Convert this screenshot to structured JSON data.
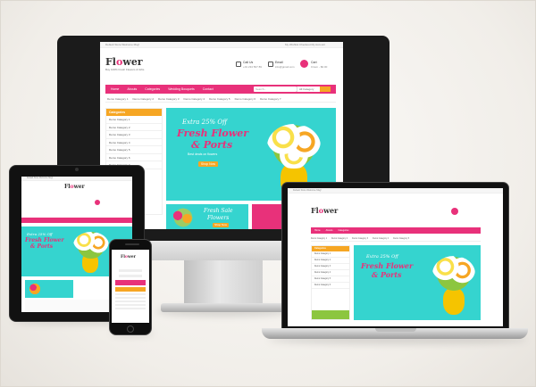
{
  "brand": {
    "logo_a": "Fl",
    "logo_o": "o",
    "logo_b": "wer",
    "tagline": "Buy 100% Fresh Flowers & Gifts"
  },
  "topbar": {
    "welcome": "Default Store Welcome Msg!",
    "links": "My Wishlist  Checkout  My Account"
  },
  "header": {
    "call_label": "Call Us",
    "call_value": "+01 234 567 89",
    "mail_label": "Email",
    "mail_value": "info@gmail.com",
    "cart_label": "Cart",
    "cart_value": "0 item - $0.00"
  },
  "nav": [
    "Home",
    "Abouts",
    "Categories",
    "Wedding Bouquets",
    "Contact"
  ],
  "search": {
    "placeholder": "Search...",
    "category": "All Category"
  },
  "subnav": [
    "Demo Category 1",
    "Demo Category 2",
    "Demo Category 3",
    "Demo Category 4",
    "Demo Category 5",
    "Demo Category 6",
    "Demo Category 7",
    "Demo Category 8"
  ],
  "sidebar": {
    "title": "Categories",
    "items": [
      "Demo Category 1",
      "Demo Category 2",
      "Demo Category 3",
      "Demo Category 4",
      "Demo Category 5",
      "Demo Category 6",
      "Demo Category 7",
      "Demo Category 8"
    ]
  },
  "banner": {
    "small": "Extra 25% Off",
    "line1": "Fresh Flower",
    "line2": "& Ports",
    "caption": "Best deals on flowers",
    "button": "Shop Now"
  },
  "promo": {
    "title1": "Fresh Sale",
    "title2": "Flowers",
    "button": "Shop Now"
  },
  "colors": {
    "pink": "#e8317a",
    "teal": "#35d4cf",
    "orange": "#f6a623",
    "yellow": "#f5c400"
  }
}
